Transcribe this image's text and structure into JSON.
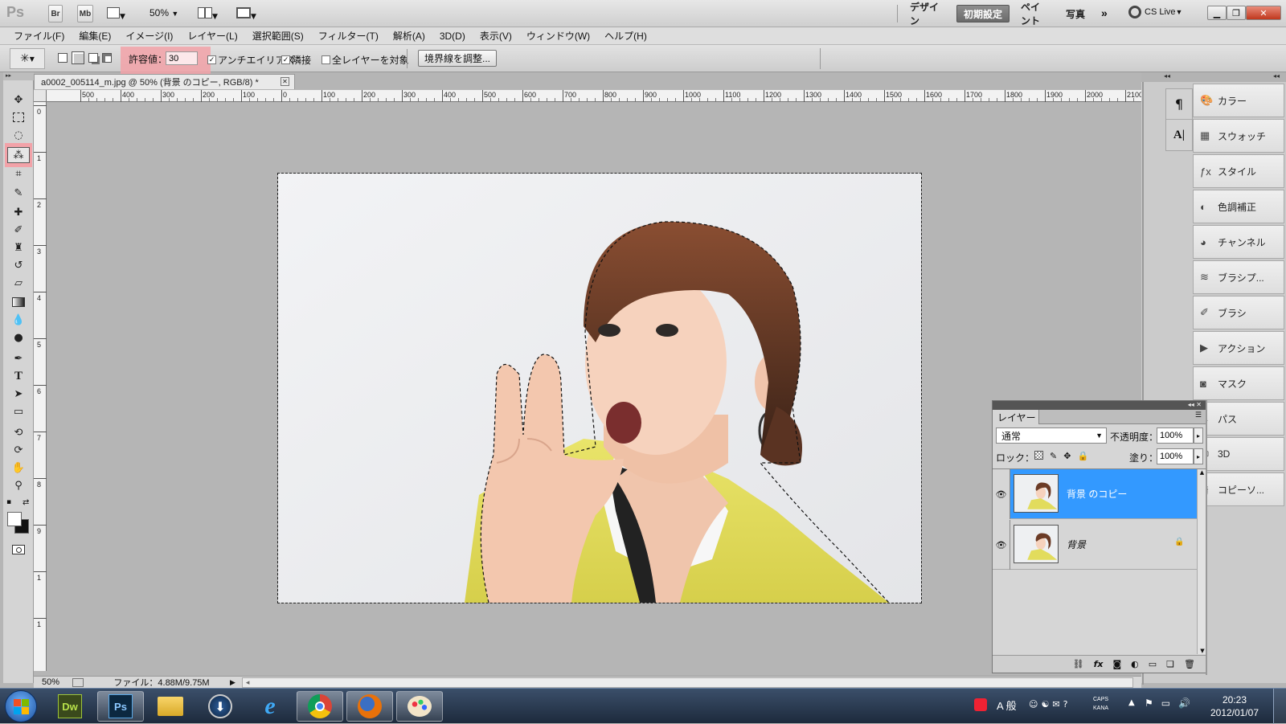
{
  "app": {
    "logo": "Ps",
    "bridge_label": "Br",
    "minibridge_label": "Mb",
    "zoom": "50%",
    "workspaces": [
      {
        "label": "デザイン",
        "active": false
      },
      {
        "label": "初期設定",
        "active": true
      },
      {
        "label": "ペイント",
        "active": false
      },
      {
        "label": "写真",
        "active": false
      }
    ],
    "more": "»",
    "cslive": "CS Live"
  },
  "menu": [
    "ファイル(F)",
    "編集(E)",
    "イメージ(I)",
    "レイヤー(L)",
    "選択範囲(S)",
    "フィルター(T)",
    "解析(A)",
    "3D(D)",
    "表示(V)",
    "ウィンドウ(W)",
    "ヘルプ(H)"
  ],
  "options": {
    "tolerance_label": "許容値：",
    "tolerance_value": "30",
    "antialias": {
      "label": "アンチエイリアス",
      "checked": true
    },
    "contiguous": {
      "label": "隣接",
      "checked": true
    },
    "all_layers": {
      "label": "全レイヤーを対象",
      "checked": false
    },
    "refine_edge": "境界線を調整..."
  },
  "document": {
    "tab_title": "a0002_005114_m.jpg @ 50% (背景 のコピー, RGB/8) *",
    "ruler_labels": [
      "500",
      "400",
      "300",
      "200",
      "100",
      "0",
      "100",
      "200",
      "300",
      "400",
      "500",
      "600",
      "700",
      "800",
      "900",
      "1000",
      "1100",
      "1200",
      "1300",
      "1400",
      "1500",
      "1600",
      "1700",
      "1800",
      "1900",
      "2000",
      "2100"
    ],
    "vruler_labels": [
      "0",
      "1",
      "2",
      "3",
      "4",
      "5",
      "6",
      "7",
      "8",
      "9",
      "1",
      "1"
    ]
  },
  "status": {
    "zoom": "50%",
    "file_info": "ファイル：4.88M/9.75M"
  },
  "panels": [
    {
      "label": "カラー",
      "icon": "palette-icon"
    },
    {
      "label": "スウォッチ",
      "icon": "swatches-icon"
    },
    {
      "label": "スタイル",
      "icon": "fx-icon"
    },
    {
      "label": "色調補正",
      "icon": "adjustments-icon"
    },
    {
      "label": "チャンネル",
      "icon": "channels-icon"
    },
    {
      "label": "ブラシプ...",
      "icon": "brush-presets-icon"
    },
    {
      "label": "ブラシ",
      "icon": "brush-icon"
    },
    {
      "label": "アクション",
      "icon": "actions-icon"
    },
    {
      "label": "マスク",
      "icon": "mask-icon"
    },
    {
      "label": "パス",
      "icon": "paths-icon"
    },
    {
      "label": "3D",
      "icon": "3d-icon"
    },
    {
      "label": "コピーソ...",
      "icon": "clone-source-icon"
    }
  ],
  "layers_panel": {
    "title": "レイヤー",
    "blend_mode": "通常",
    "opacity_label": "不透明度：",
    "opacity": "100%",
    "lock_label": "ロック：",
    "fill_label": "塗り：",
    "fill": "100%",
    "layers": [
      {
        "name": "背景 のコピー",
        "selected": true,
        "locked": false
      },
      {
        "name": "背景",
        "selected": false,
        "locked": true
      }
    ]
  },
  "taskbar": {
    "apps": [
      {
        "label": "Dw",
        "name": "dreamweaver"
      },
      {
        "label": "Ps",
        "name": "photoshop"
      },
      {
        "label": "",
        "name": "explorer"
      },
      {
        "label": "",
        "name": "download"
      },
      {
        "label": "e",
        "name": "internet-explorer"
      },
      {
        "label": "",
        "name": "chrome"
      },
      {
        "label": "",
        "name": "firefox"
      },
      {
        "label": "",
        "name": "paint"
      }
    ],
    "ime": "A 般",
    "caps": "CAPS",
    "kana": "KANA",
    "time": "20:23",
    "date": "2012/01/07"
  },
  "colors": {
    "selected_layer": "#3399ff",
    "highlight": "#f2a2a8",
    "accent": "#2f6fb5"
  }
}
